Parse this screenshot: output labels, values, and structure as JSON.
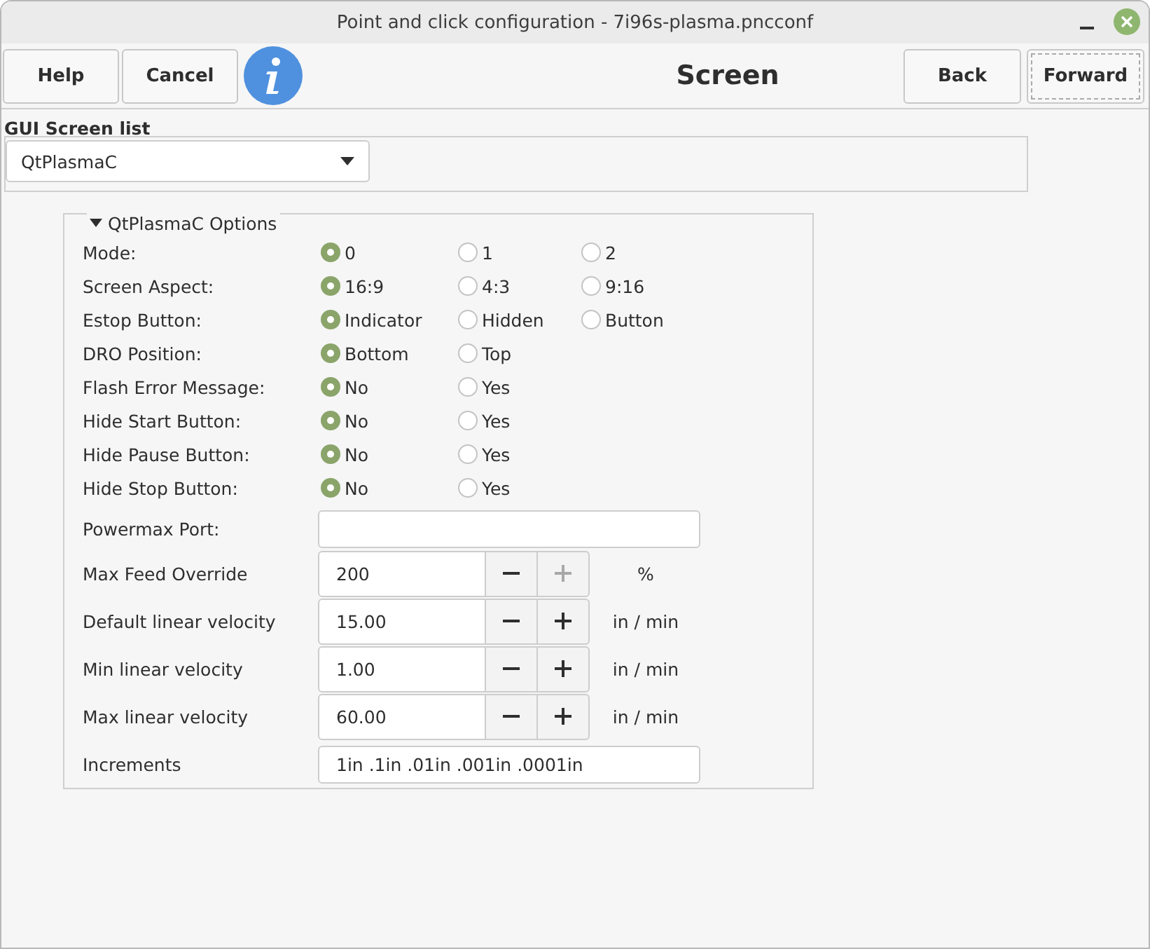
{
  "window": {
    "title": "Point and click configuration - 7i96s-plasma.pncconf"
  },
  "toolbar": {
    "left_buttons": [
      "Help",
      "Cancel"
    ],
    "heading": "Screen",
    "right_buttons": [
      "Back",
      "Forward"
    ]
  },
  "gui_screen_list": {
    "label": "GUI Screen list",
    "value": "QtPlasmaC"
  },
  "options": {
    "title": "QtPlasmaC Options",
    "expanded": true,
    "radio_rows": [
      {
        "label": "Mode:",
        "choices": [
          {
            "label": "0",
            "selected": true
          },
          {
            "label": "1",
            "selected": false
          },
          {
            "label": "2",
            "selected": false
          }
        ]
      },
      {
        "label": "Screen Aspect:",
        "choices": [
          {
            "label": "16:9",
            "selected": true
          },
          {
            "label": "4:3",
            "selected": false
          },
          {
            "label": "9:16",
            "selected": false
          }
        ]
      },
      {
        "label": "Estop Button:",
        "choices": [
          {
            "label": "Indicator",
            "selected": true
          },
          {
            "label": "Hidden",
            "selected": false
          },
          {
            "label": "Button",
            "selected": false
          }
        ]
      },
      {
        "label": "DRO Position:",
        "choices": [
          {
            "label": "Bottom",
            "selected": true
          },
          {
            "label": "Top",
            "selected": false
          }
        ]
      },
      {
        "label": "Flash Error Message:",
        "choices": [
          {
            "label": "No",
            "selected": true
          },
          {
            "label": "Yes",
            "selected": false
          }
        ]
      },
      {
        "label": "Hide Start Button:",
        "choices": [
          {
            "label": "No",
            "selected": true
          },
          {
            "label": "Yes",
            "selected": false
          }
        ]
      },
      {
        "label": "Hide Pause Button:",
        "choices": [
          {
            "label": "No",
            "selected": true
          },
          {
            "label": "Yes",
            "selected": false
          }
        ]
      },
      {
        "label": "Hide Stop Button:",
        "choices": [
          {
            "label": "No",
            "selected": true
          },
          {
            "label": "Yes",
            "selected": false
          }
        ]
      }
    ],
    "fields": [
      {
        "kind": "entry",
        "label": "Powermax Port:"
      },
      {
        "kind": "spin",
        "label": "Max Feed Override",
        "value": "200",
        "unit": "%",
        "plus_disabled": true
      },
      {
        "kind": "spin",
        "label": "Default linear velocity",
        "value": "15.00",
        "unit": "in / min",
        "plus_disabled": false
      },
      {
        "kind": "spin",
        "label": "Min linear velocity",
        "value": "1.00",
        "unit": "in / min",
        "plus_disabled": false
      },
      {
        "kind": "spin",
        "label": "Max linear velocity",
        "value": "60.00",
        "unit": "in / min",
        "plus_disabled": false
      },
      {
        "kind": "entry",
        "label": "Increments",
        "value": "1in .1in .01in .001in .0001in"
      }
    ]
  }
}
